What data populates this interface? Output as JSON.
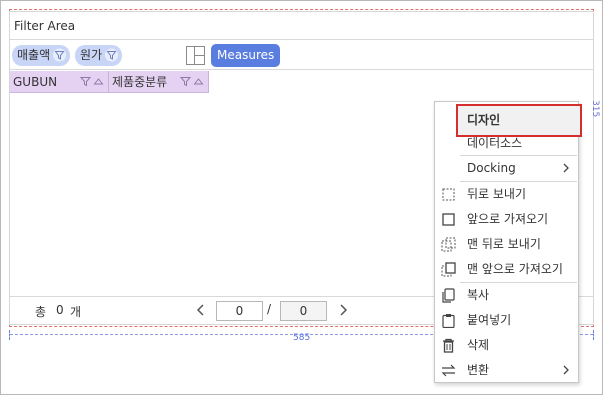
{
  "filter_area": {
    "label": "Filter Area"
  },
  "filter_chips": [
    {
      "label": "매출액",
      "icon": "filter-icon"
    },
    {
      "label": "원가",
      "icon": "filter-icon"
    }
  ],
  "layout_button": {
    "icon": "layout-icon"
  },
  "measures_button": {
    "label": "Measures"
  },
  "columns": [
    {
      "label": "GUBUN"
    },
    {
      "label": "제품중분류"
    }
  ],
  "footer": {
    "total_label": "총",
    "total_count": "0",
    "total_unit": "개",
    "current_page": "0",
    "page_separator": "/",
    "total_pages": "0"
  },
  "dimensions": {
    "width_label": "585",
    "height_label": "315"
  },
  "context_menu": {
    "items": [
      {
        "label": "디자인",
        "icon": "",
        "submenu": false,
        "highlighted": true
      },
      {
        "label": "데이터소스",
        "icon": "",
        "submenu": false
      },
      {
        "label": "Docking",
        "icon": "",
        "submenu": true
      },
      {
        "label": "뒤로 보내기",
        "icon": "send-backward-icon",
        "submenu": false
      },
      {
        "label": "앞으로 가져오기",
        "icon": "bring-forward-icon",
        "submenu": false
      },
      {
        "label": "맨 뒤로 보내기",
        "icon": "send-to-back-icon",
        "submenu": false
      },
      {
        "label": "맨 앞으로 가져오기",
        "icon": "bring-to-front-icon",
        "submenu": false
      },
      {
        "label": "복사",
        "icon": "copy-icon",
        "submenu": false
      },
      {
        "label": "붙여넣기",
        "icon": "paste-icon",
        "submenu": false
      },
      {
        "label": "삭제",
        "icon": "trash-icon",
        "submenu": false
      },
      {
        "label": "변환",
        "icon": "convert-icon",
        "submenu": true
      }
    ]
  },
  "colors": {
    "chip_bg": "#c9d5f7",
    "measures_bg": "#5a7de0",
    "column_header_bg": "#e5d2f3",
    "highlight_border": "#d42e2e"
  }
}
